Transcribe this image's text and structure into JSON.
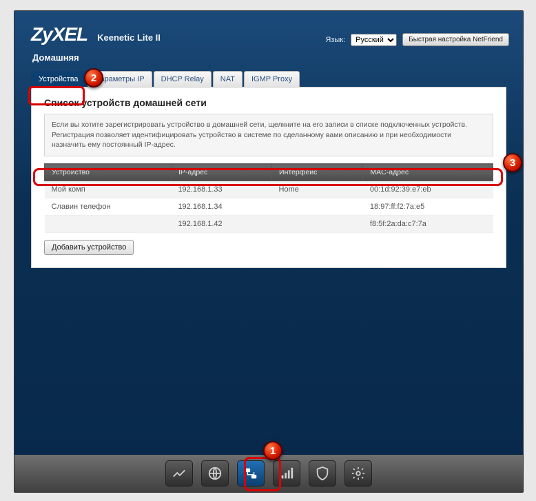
{
  "header": {
    "brand": "ZyXEL",
    "model": "Keenetic Lite II",
    "lang_label": "Язык:",
    "lang_value": "Русский",
    "netfriend": "Быстрая настройка NetFriend",
    "breadcrumb": "Домашняя"
  },
  "tabs": [
    {
      "label": "Устройства",
      "active": true
    },
    {
      "label": "Параметры IP",
      "active": false
    },
    {
      "label": "DHCP Relay",
      "active": false
    },
    {
      "label": "NAT",
      "active": false
    },
    {
      "label": "IGMP Proxy",
      "active": false
    }
  ],
  "panel": {
    "title": "Список устройств домашней сети",
    "info": "Если вы хотите зарегистрировать устройство в домашней сети, щелкните на его записи в списке подключенных устройств. Регистрация позволяет идентифицировать устройство в системе по сделанному вами описанию и при необходимости назначить ему постоянный IP-адрес.",
    "columns": {
      "device": "Устройство",
      "ip": "IP-адрес",
      "iface": "Интерфейс",
      "mac": "MAC-адрес"
    },
    "rows": [
      {
        "device": "Мой комп",
        "ip": "192.168.1.33",
        "iface": "Home",
        "mac": "00:1d:92:39:e7:eb"
      },
      {
        "device": "Славин телефон",
        "ip": "192.168.1.34",
        "iface": "",
        "mac": "18:97:ff:f2:7a:e5"
      },
      {
        "device": "",
        "ip": "192.168.1.42",
        "iface": "",
        "mac": "f8:5f:2a:da:c7:7a"
      }
    ],
    "add_btn": "Добавить устройство"
  },
  "bottom_icons": [
    "monitor-icon",
    "globe-icon",
    "network-icon",
    "wifi-icon",
    "shield-icon",
    "gear-icon"
  ],
  "badges": {
    "b1": "1",
    "b2": "2",
    "b3": "3"
  }
}
